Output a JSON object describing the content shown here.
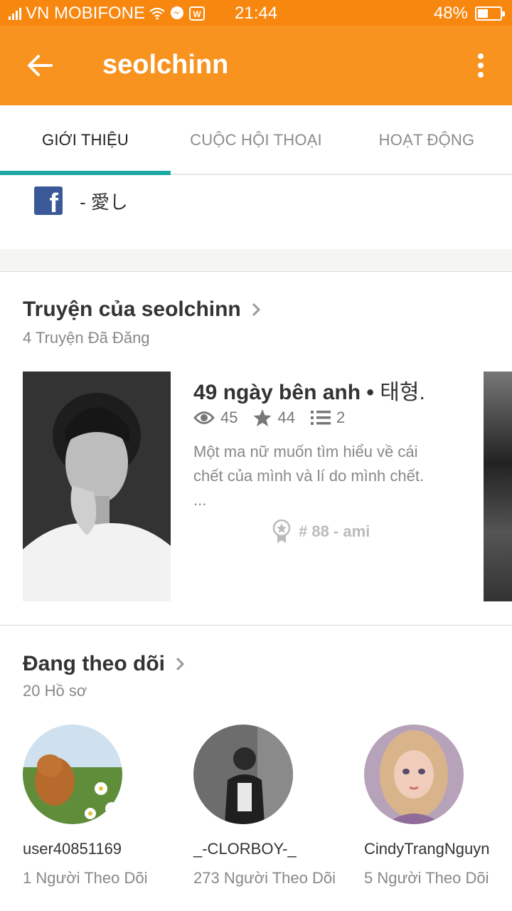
{
  "status_bar": {
    "carrier": "VN MOBIFONE",
    "time": "21:44",
    "battery": "48%",
    "battery_level": 0.48
  },
  "app_bar": {
    "title": "seolchinn",
    "back_icon": "arrow-left-icon",
    "more_icon": "more-vert-icon"
  },
  "tabs": [
    {
      "label": "GIỚI THIỆU",
      "active": true
    },
    {
      "label": "CUỘC HỘI THOẠI",
      "active": false
    },
    {
      "label": "HOẠT ĐỘNG",
      "active": false
    }
  ],
  "about": {
    "facebook_text": "- 愛し"
  },
  "stories_section": {
    "title": "Truyện của seolchinn",
    "subtitle": "4 Truyện Đã Đăng",
    "story": {
      "title": "49 ngày bên anh • ",
      "title_korean": "태형.",
      "views": "45",
      "votes": "44",
      "parts": "2",
      "description_line1": "Một ma nữ muốn tìm hiểu về cái",
      "description_line2": "chết của mình và lí do mình chết.",
      "description_ellipsis": "...",
      "rank": "# 88 - ami"
    }
  },
  "following_section": {
    "title": "Đang theo dõi",
    "subtitle": "20 Hồ sơ",
    "users": [
      {
        "name": "user40851169",
        "followers": "1 Người Theo Dõi"
      },
      {
        "name": "_-CLORBOY-_",
        "followers": "273 Người Theo Dõi"
      },
      {
        "name": "CindyTrangNguyn",
        "followers": "5 Người Theo Dõi"
      }
    ]
  },
  "colors": {
    "status_bar": "#f7870f",
    "app_bar": "#f7931e",
    "tab_indicator": "#1ea8a6",
    "facebook": "#3b5998"
  }
}
